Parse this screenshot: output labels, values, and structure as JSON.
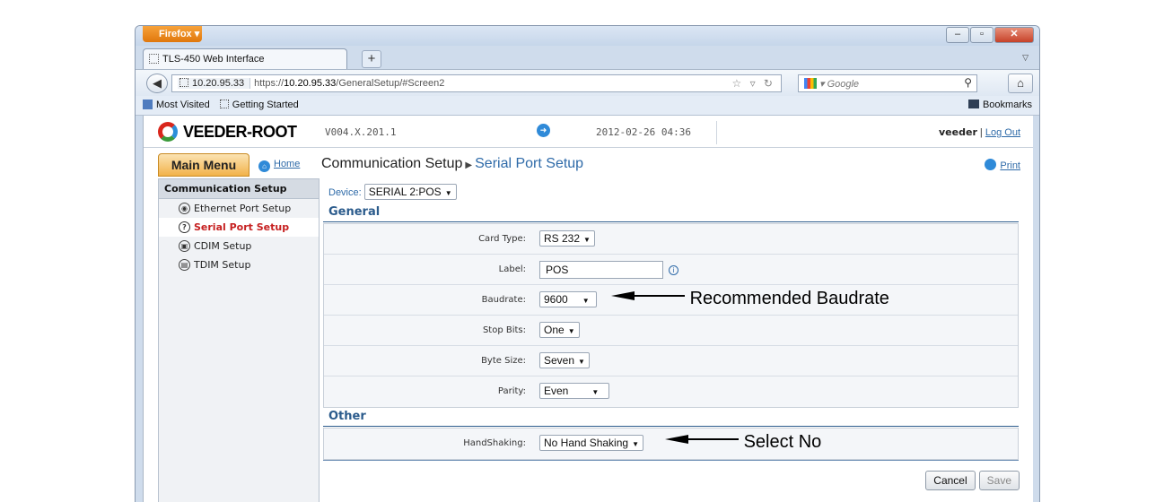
{
  "browser": {
    "app_button": "Firefox ▾",
    "tab_title": "TLS-450 Web Interface",
    "new_tab": "+",
    "url_identity": "10.20.95.33",
    "url_prefix": "https://",
    "url_host": "10.20.95.33",
    "url_path": "/GeneralSetup/#Screen2",
    "search_placeholder": "Google",
    "bookmarks": [
      "Most Visited",
      "Getting Started"
    ],
    "bookmarks_menu": "Bookmarks"
  },
  "header": {
    "logo": "VEEDER-ROOT",
    "version": "V004.X.201.1",
    "datetime": "2012-02-26 04:36",
    "user": "veeder",
    "logout": "Log Out"
  },
  "nav": {
    "main_menu": "Main Menu",
    "home": "Home",
    "breadcrumb_parent": "Communication Setup",
    "breadcrumb_current": "Serial Port Setup",
    "print": "Print"
  },
  "sidebar": {
    "title": "Communication Setup",
    "items": [
      {
        "label": "Ethernet Port Setup",
        "icon": "ethernet-icon"
      },
      {
        "label": "Serial Port Setup",
        "icon": "serial-icon",
        "active": true
      },
      {
        "label": "CDIM Setup",
        "icon": "cdim-icon"
      },
      {
        "label": "TDIM Setup",
        "icon": "tdim-icon"
      }
    ]
  },
  "form": {
    "device_label": "Device:",
    "device_value": "SERIAL 2:POS",
    "general_title": "General",
    "other_title": "Other",
    "fields": [
      {
        "label": "Card Type:",
        "value": "RS 232"
      },
      {
        "label": "Label:",
        "value": "POS"
      },
      {
        "label": "Baudrate:",
        "value": "9600"
      },
      {
        "label": "Stop Bits:",
        "value": "One"
      },
      {
        "label": "Byte Size:",
        "value": "Seven"
      },
      {
        "label": "Parity:",
        "value": "Even"
      }
    ],
    "handshaking": {
      "label": "HandShaking:",
      "value": "No Hand Shaking"
    },
    "cancel": "Cancel",
    "save": "Save"
  },
  "annotations": {
    "baudrate": "Recommended Baudrate",
    "handshaking": "Select No"
  }
}
